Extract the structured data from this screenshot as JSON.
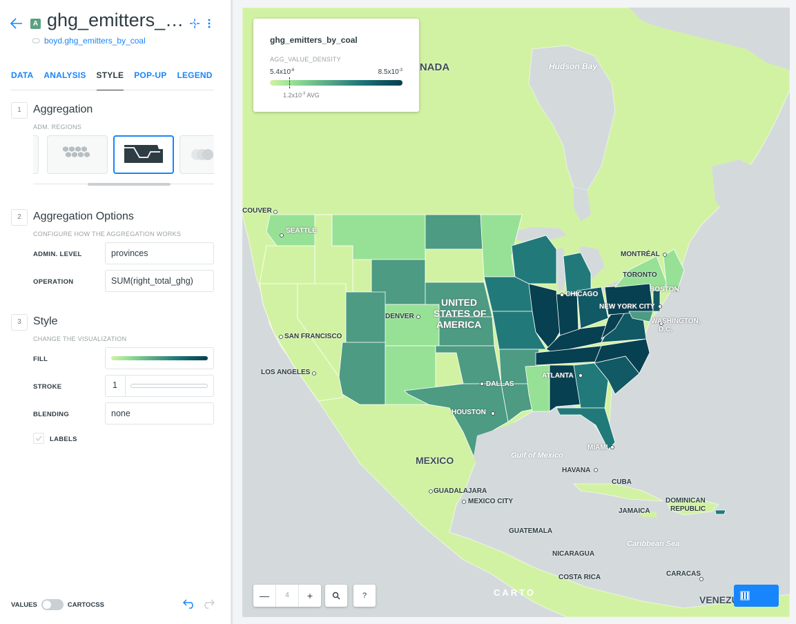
{
  "header": {
    "badge_letter": "A",
    "title": "ghg_emitters_…",
    "source": "boyd.ghg_emitters_by_coal"
  },
  "tabs": [
    "DATA",
    "ANALYSIS",
    "STYLE",
    "POP-UP",
    "LEGEND"
  ],
  "active_tab": "STYLE",
  "sections": {
    "aggregation": {
      "number": "1",
      "title": "Aggregation",
      "subtitle": "ADM. REGIONS"
    },
    "options": {
      "number": "2",
      "title": "Aggregation Options",
      "subtitle": "CONFIGURE HOW THE AGGREGATION WORKS",
      "admin_level_label": "ADMIN. LEVEL",
      "admin_level_value": "provinces",
      "operation_label": "OPERATION",
      "operation_value": "SUM(right_total_ghg)"
    },
    "style": {
      "number": "3",
      "title": "Style",
      "subtitle": "CHANGE THE VISUALIZATION",
      "fill_label": "FILL",
      "stroke_label": "STROKE",
      "stroke_value": "1",
      "blending_label": "BLENDING",
      "blending_value": "none",
      "labels_label": "LABELS"
    }
  },
  "footer": {
    "values_label": "VALUES",
    "cartocss_label": "CARTOCSS"
  },
  "legend": {
    "title": "ghg_emitters_by_coal",
    "subtitle": "AGG_VALUE_DENSITY",
    "min_base": "5.4x10",
    "min_exp": "-6",
    "max_base": "8.5x10",
    "max_exp": "-3",
    "avg_base": "1.2x10",
    "avg_exp": "-3",
    "avg_suffix": " AVG"
  },
  "map": {
    "zoom_level": "4",
    "zoom_out": "—",
    "zoom_in": "+",
    "search": "⌕",
    "help": "?",
    "attribution": "CARTO",
    "colors": {
      "water": "#d4dadc",
      "land": "#d2f2a3",
      "c1": "#97e196",
      "c2": "#6cc08b",
      "c3": "#4c9b82",
      "c4": "#217a79",
      "c5": "#105965",
      "c6": "#074050"
    },
    "labels": {
      "hudson_bay": "Hudson Bay",
      "canada": "ANADA",
      "vancouver": "COUVER",
      "seattle": "SEATTLE",
      "montreal": "MONTRÉAL",
      "toronto": "TORONTO",
      "boston": "BOSTON",
      "chicago": "CHICAGO",
      "new_york": "NEW YORK CITY",
      "washington": "WASHINGTON,",
      "washington2": "D.C.",
      "usa1": "UNITED",
      "usa2": "STATES OF",
      "usa3": "AMERICA",
      "denver": "DENVER",
      "san_francisco": "SAN FRANCISCO",
      "los_angeles": "LOS ANGELES",
      "dallas": "DALLAS",
      "atlanta": "ATLANTA",
      "houston": "HOUSTON",
      "miami": "MIAMI",
      "mexico": "MEXICO",
      "gulf": "Gulf of Mexico",
      "havana": "HAVANA",
      "cuba": "CUBA",
      "guadalajara": "GUADALAJARA",
      "mexico_city": "MEXICO CITY",
      "dominican1": "DOMINICAN",
      "dominican2": "REPUBLIC",
      "jamaica": "JAMAICA",
      "guatemala": "GUATEMALA",
      "caribbean": "Caribbean Sea",
      "nicaragua": "NICARAGUA",
      "costa_rica": "COSTA RICA",
      "caracas": "CARACAS",
      "venezuela": "VENEZU"
    }
  }
}
